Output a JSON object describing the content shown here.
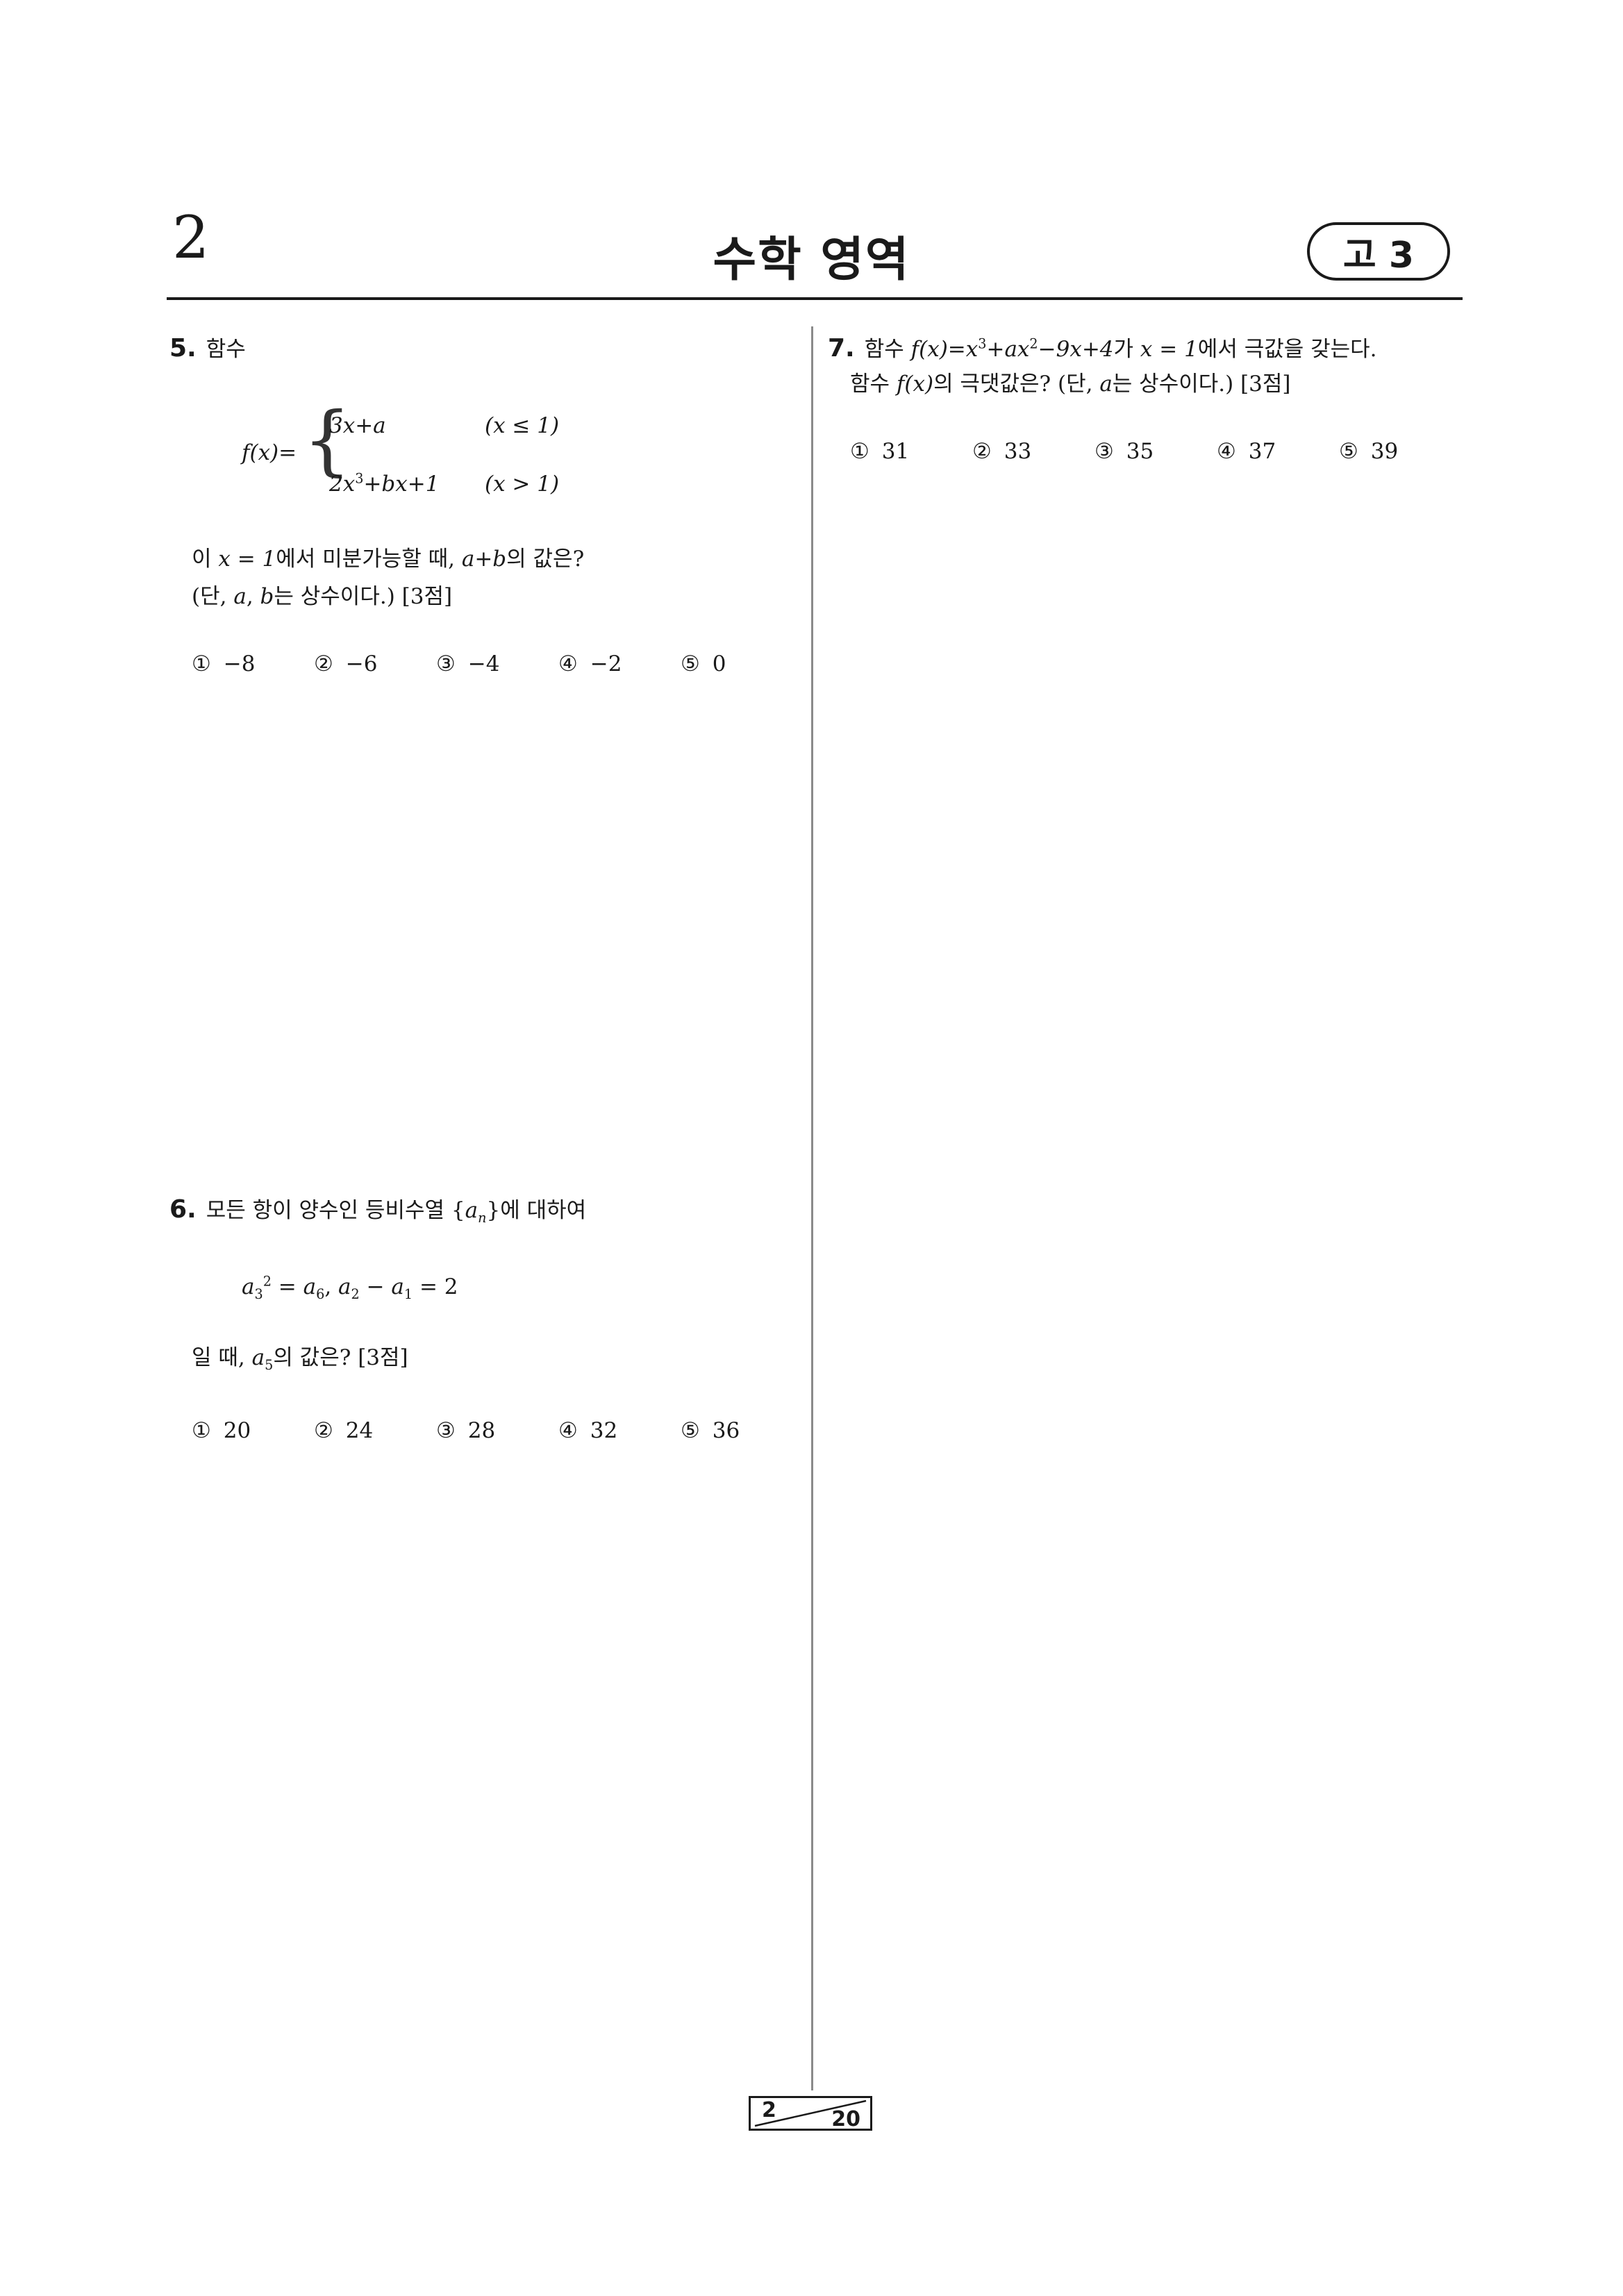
{
  "header": {
    "page_number": "2",
    "title": "수학 영역",
    "grade": "고 3"
  },
  "footer": {
    "current_page": "2",
    "total_pages": "20"
  },
  "questions": [
    {
      "number": "5.",
      "intro": "함수",
      "piece1": {
        "expr": "3x+a",
        "cond": "(x ≤ 1)"
      },
      "piece2": {
        "expr_a": "2x",
        "exp": "3",
        "expr_b": "+bx+1",
        "cond": "(x > 1)"
      },
      "func_lhs": "f(x)=",
      "line1": {
        "pre": "이 ",
        "eq": "x = 1",
        "mid": "에서 미분가능할 때, ",
        "sum": "a+b",
        "post": "의 값은?"
      },
      "line2": {
        "pre": "(단, ",
        "a": "a",
        "comma": ", ",
        "b": "b",
        "post": "는 상수이다.) [3점]"
      },
      "choices": [
        {
          "mark": "①",
          "value": "−8"
        },
        {
          "mark": "②",
          "value": "−6"
        },
        {
          "mark": "③",
          "value": "−4"
        },
        {
          "mark": "④",
          "value": "−2"
        },
        {
          "mark": "⑤",
          "value": "0"
        }
      ]
    },
    {
      "number": "6.",
      "intro_pre": "모든 항이 양수인 등비수열 ",
      "seq": "a",
      "seq_sub": "n",
      "intro_post": "에 대하여",
      "cond": {
        "a3": "a",
        "a3_sub": "3",
        "a3_sup": "2",
        "eq1": " = ",
        "a6": "a",
        "a6_sub": "6",
        "sep": ",  ",
        "a2": "a",
        "a2_sub": "2",
        "minus": " − ",
        "a1": "a",
        "a1_sub": "1",
        "eq2": " = 2"
      },
      "ask_pre": "일 때, ",
      "ask_var": "a",
      "ask_sub": "5",
      "ask_post": "의 값은? [3점]",
      "choices": [
        {
          "mark": "①",
          "value": "20"
        },
        {
          "mark": "②",
          "value": "24"
        },
        {
          "mark": "③",
          "value": "28"
        },
        {
          "mark": "④",
          "value": "32"
        },
        {
          "mark": "⑤",
          "value": "36"
        }
      ]
    },
    {
      "number": "7.",
      "line1": {
        "pre": "함수 ",
        "f": "f(x)=x",
        "e1": "3",
        "m1": "+ax",
        "e2": "2",
        "m2": "−9x+4",
        "mid": "가 ",
        "eq": "x = 1",
        "post": "에서 극값을 갖는다."
      },
      "line2": {
        "pre": "함수 ",
        "f": "f(x)",
        "mid": "의 극댓값은? (단, ",
        "a": "a",
        "post": "는 상수이다.) [3점]"
      },
      "choices": [
        {
          "mark": "①",
          "value": "31"
        },
        {
          "mark": "②",
          "value": "33"
        },
        {
          "mark": "③",
          "value": "35"
        },
        {
          "mark": "④",
          "value": "37"
        },
        {
          "mark": "⑤",
          "value": "39"
        }
      ]
    }
  ]
}
